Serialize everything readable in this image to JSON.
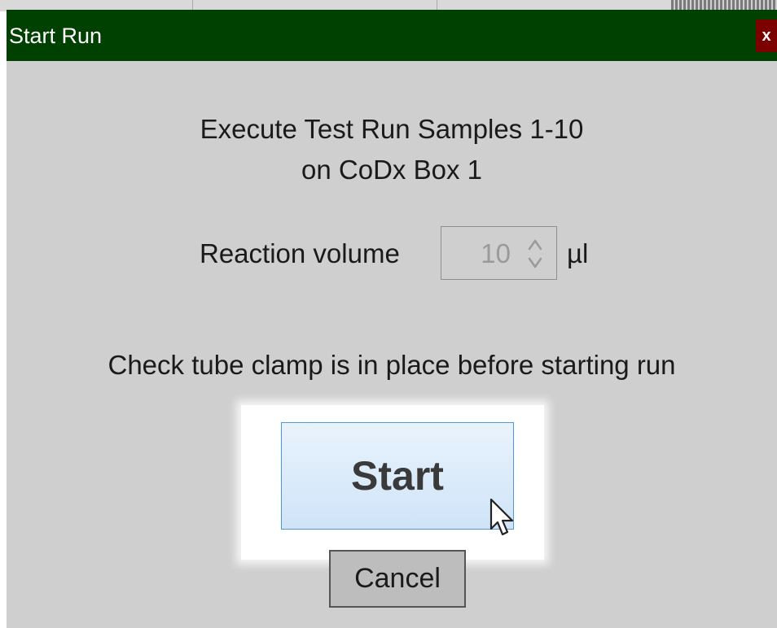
{
  "dialog": {
    "title": "Start Run",
    "close_label": "x"
  },
  "content": {
    "heading_line1": "Execute Test Run Samples 1-10",
    "heading_line2": "on CoDx Box 1",
    "volume": {
      "label": "Reaction volume",
      "value": "10",
      "unit": "µl"
    },
    "notice": "Check tube clamp is in place before starting run"
  },
  "buttons": {
    "start_label": "Start",
    "cancel_label": "Cancel"
  },
  "colors": {
    "title_bar": "#004000",
    "close_button": "#7d0000",
    "dialog_background": "#cfcfcf",
    "start_button_border": "#4e9ad8"
  },
  "icons": {
    "spin_up": "chevron-up-icon",
    "spin_down": "chevron-down-icon",
    "cursor": "mouse-pointer-icon"
  }
}
